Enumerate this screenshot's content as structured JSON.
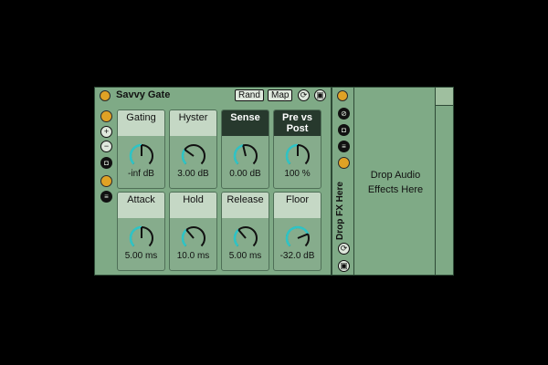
{
  "device": {
    "title": "Savvy Gate",
    "rand_label": "Rand",
    "map_label": "Map",
    "side_icons": [
      "hot-swap-icon",
      "plus-icon",
      "minus-icon",
      "camera-icon",
      "collapse-icon",
      "list-icon"
    ],
    "params": [
      {
        "label": "Gating",
        "value": "-inf dB",
        "level": 0.5,
        "dark": false
      },
      {
        "label": "Hyster",
        "value": "3.00 dB",
        "level": 0.3,
        "dark": false
      },
      {
        "label": "Sense",
        "value": "0.00 dB",
        "level": 0.45,
        "dark": true
      },
      {
        "label": "Pre vs Post",
        "value": "100 %",
        "level": 0.5,
        "dark": true
      },
      {
        "label": "Attack",
        "value": "5.00 ms",
        "level": 0.5,
        "dark": false
      },
      {
        "label": "Hold",
        "value": "10.0 ms",
        "level": 0.35,
        "dark": false
      },
      {
        "label": "Release",
        "value": "5.00 ms",
        "level": 0.35,
        "dark": false
      },
      {
        "label": "Floor",
        "value": "-32.0 dB",
        "level": 0.75,
        "dark": false
      }
    ]
  },
  "rack": {
    "vertical_label": "Drop FX Here",
    "drop_text": "Drop Audio Effects Here"
  },
  "colors": {
    "panel": "#7faa86",
    "accent": "#2ec4c6",
    "power": "#e0a225"
  }
}
